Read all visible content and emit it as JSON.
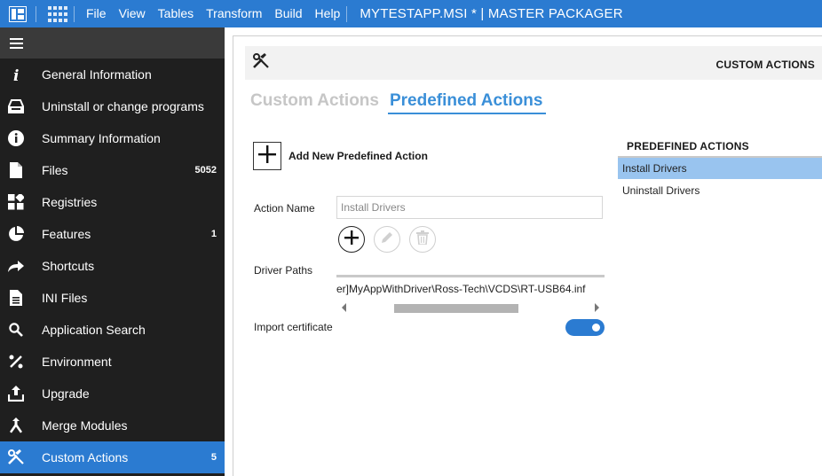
{
  "app": {
    "title": "MYTESTAPP.MSI * | MASTER PACKAGER",
    "menu": [
      "File",
      "View",
      "Tables",
      "Transform",
      "Build",
      "Help"
    ]
  },
  "colors": {
    "accent": "#2b7bd1",
    "sidebar_bg": "#1f1f1f",
    "selected_row": "#99c4ef"
  },
  "sidebar": {
    "items": [
      {
        "label": "General Information",
        "icon": "info-italic-icon",
        "count": ""
      },
      {
        "label": "Uninstall or change programs",
        "icon": "drive-icon",
        "count": ""
      },
      {
        "label": "Summary Information",
        "icon": "info-circle-icon",
        "count": ""
      },
      {
        "label": "Files",
        "icon": "file-icon",
        "count": "5052"
      },
      {
        "label": "Registries",
        "icon": "registry-icon",
        "count": ""
      },
      {
        "label": "Features",
        "icon": "pie-icon",
        "count": "1"
      },
      {
        "label": "Shortcuts",
        "icon": "shortcut-arrow-icon",
        "count": ""
      },
      {
        "label": "INI Files",
        "icon": "ini-file-icon",
        "count": ""
      },
      {
        "label": "Application Search",
        "icon": "search-icon",
        "count": ""
      },
      {
        "label": "Environment",
        "icon": "percent-icon",
        "count": ""
      },
      {
        "label": "Upgrade",
        "icon": "upload-icon",
        "count": ""
      },
      {
        "label": "Merge Modules",
        "icon": "merge-icon",
        "count": ""
      },
      {
        "label": "Custom Actions",
        "icon": "tools-icon",
        "count": "5",
        "active": true
      }
    ]
  },
  "main": {
    "header_title": "CUSTOM ACTIONS",
    "tabs": [
      {
        "label": "Custom Actions",
        "active": false
      },
      {
        "label": "Predefined Actions",
        "active": true
      }
    ],
    "add_label": "Add New Predefined Action",
    "action_name_label": "Action Name",
    "action_name_value": "Install Drivers",
    "driver_paths_label": "Driver Paths",
    "driver_path_value": "er]MyAppWithDriver\\Ross-Tech\\VCDS\\RT-USB64.inf",
    "import_cert_label": "Import certificate",
    "import_cert_on": true
  },
  "predefined": {
    "title": "PREDEFINED ACTIONS",
    "items": [
      {
        "label": "Install Drivers",
        "selected": true
      },
      {
        "label": "Uninstall Drivers",
        "selected": false
      }
    ]
  }
}
